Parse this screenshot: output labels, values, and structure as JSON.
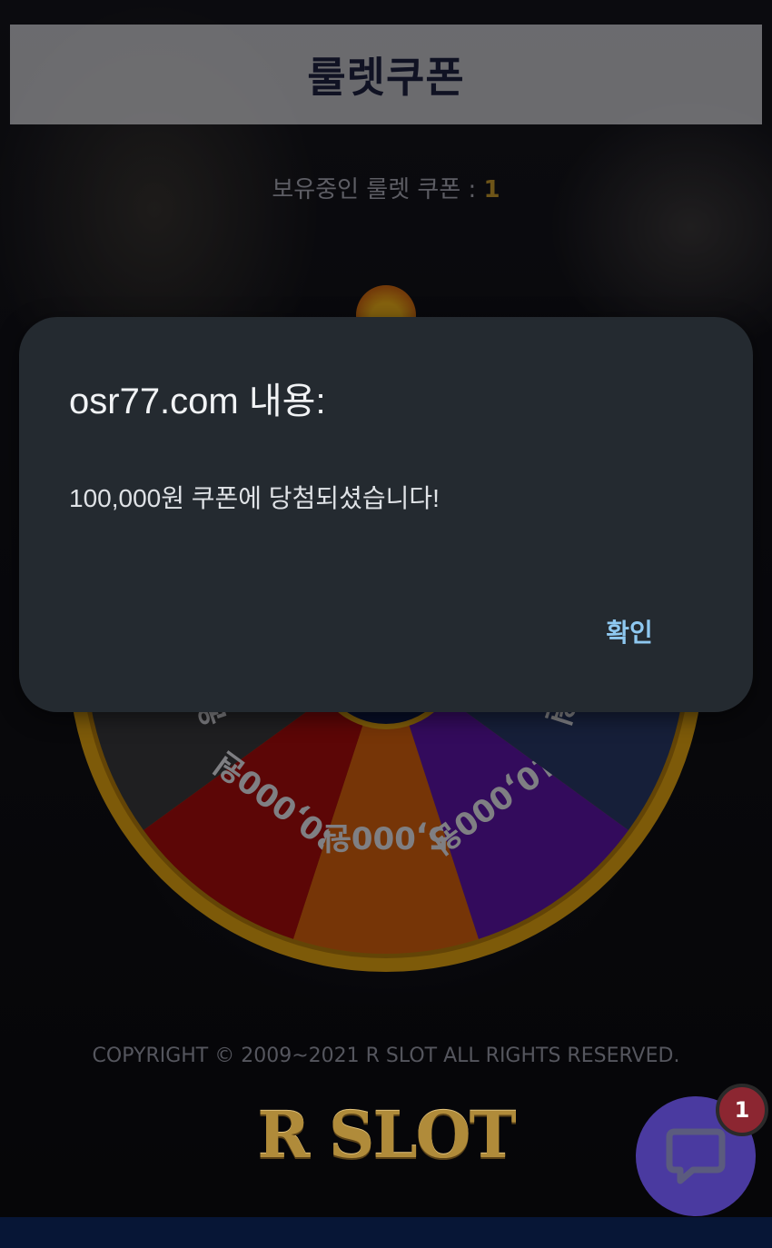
{
  "header": {
    "title": "룰렛쿠폰"
  },
  "coupons": {
    "label": "보유중인 룰렛 쿠폰 : ",
    "count": "1"
  },
  "wheel": {
    "segments": [
      {
        "label": "원",
        "color": "#3a3a3c"
      },
      {
        "label": "30,000원",
        "color": "#a80c0c"
      },
      {
        "label": "5,000원",
        "color": "#d8620e"
      },
      {
        "label": "10,000원",
        "color": "#5e14a8"
      },
      {
        "label": "원",
        "color": "#293a68"
      }
    ],
    "rim_color": "#e3a412"
  },
  "dialog": {
    "title": "osr77.com 내용:",
    "message": "100,000원 쿠폰에 당첨되셨습니다!",
    "ok_label": "확인"
  },
  "footer": {
    "copyright": "COPYRIGHT © 2009~2021 R SLOT ALL RIGHTS RESERVED.",
    "logo": "R SLOT"
  },
  "chat": {
    "badge_count": "1",
    "icon": "chat-bubble-icon"
  },
  "colors": {
    "accent": "#8ec8f0",
    "dialog_bg": "#242a30",
    "coupon_count": "#c79a2c"
  }
}
